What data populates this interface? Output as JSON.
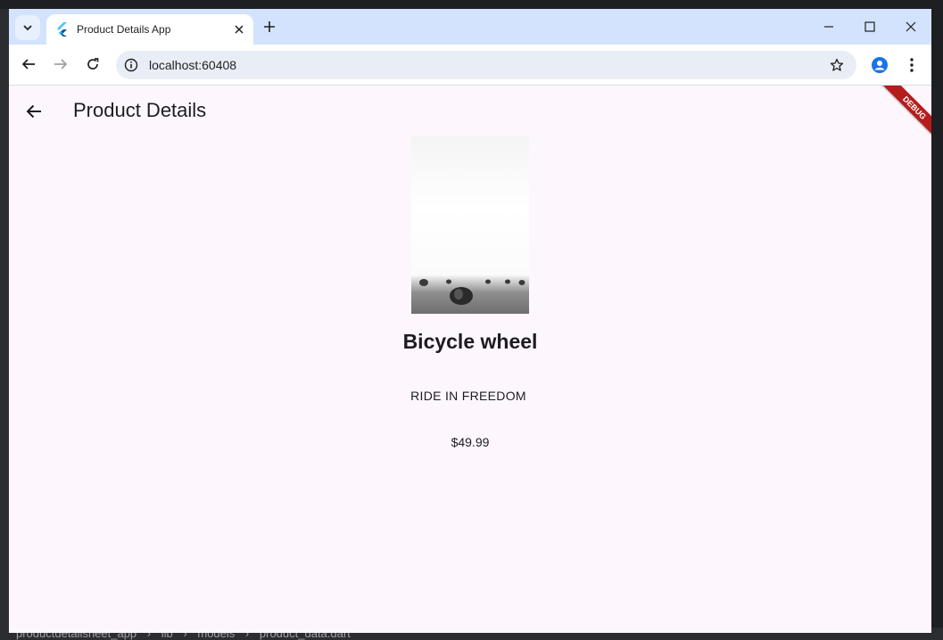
{
  "browser": {
    "tab_title": "Product Details App",
    "url": "localhost:60408",
    "icons": [
      "tab-search-chevron-icon",
      "flutter-icon",
      "close-icon",
      "plus-icon",
      "minimize-icon",
      "maximize-icon",
      "close-window-icon",
      "back-arrow-icon",
      "forward-arrow-icon",
      "reload-icon",
      "info-icon",
      "star-icon",
      "profile-icon",
      "kebab-menu-icon"
    ]
  },
  "app": {
    "title": "Product Details",
    "debug_banner": "DEBUG",
    "product": {
      "name": "Bicycle wheel",
      "tagline": "RIDE IN FREEDOM",
      "price": "$49.99",
      "image": "hay-bales-field-photo"
    },
    "accent_color": "#fdf7fd"
  },
  "ide": {
    "breadcrumb": [
      "productdetailsheet_app",
      "lib",
      "models",
      "product_data.dart"
    ]
  }
}
